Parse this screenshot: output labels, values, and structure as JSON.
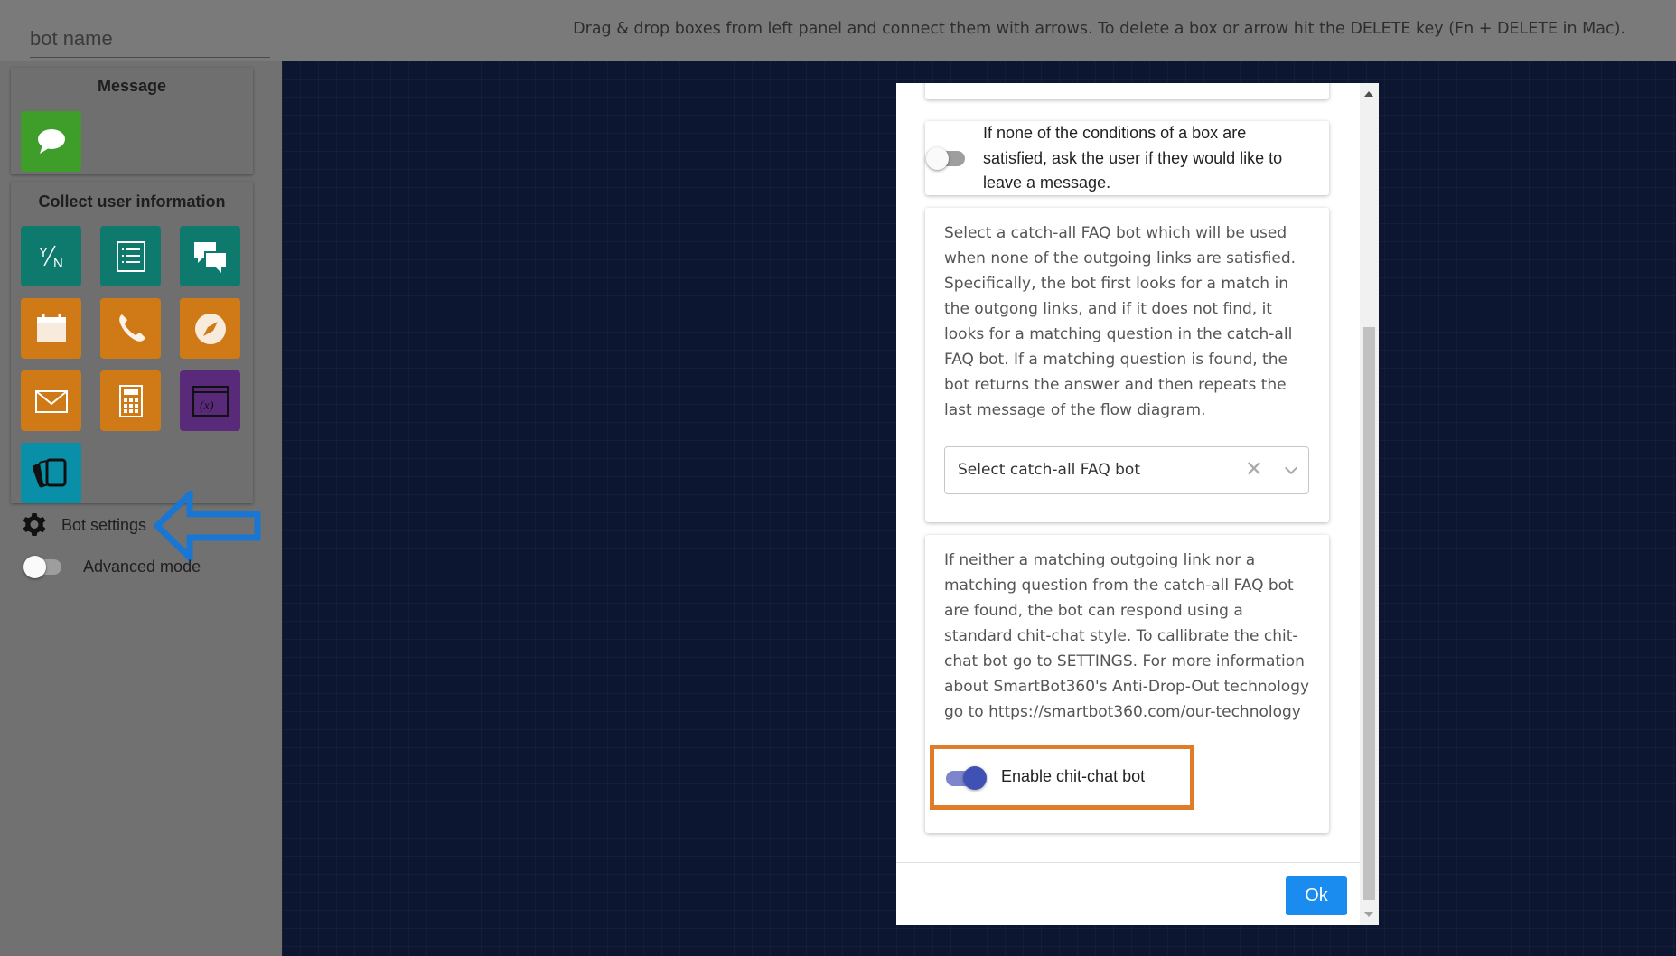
{
  "header": {
    "bot_name_placeholder": "bot name",
    "instructions": "Drag & drop boxes from left panel and connect them with arrows. To delete a box or arrow hit the DELETE key (Fn + DELETE in Mac)."
  },
  "palette": {
    "message_title": "Message",
    "collect_title": "Collect user information",
    "tiles": [
      {
        "name": "message-icon",
        "color": "#3f9d2a"
      },
      {
        "name": "yes-no-icon",
        "color": "#0e7a6d"
      },
      {
        "name": "list-icon",
        "color": "#0e7a6d"
      },
      {
        "name": "chat-icon",
        "color": "#0e7a6d"
      },
      {
        "name": "calendar-icon",
        "color": "#d07a17"
      },
      {
        "name": "phone-icon",
        "color": "#d07a17"
      },
      {
        "name": "compass-icon",
        "color": "#d07a17"
      },
      {
        "name": "email-icon",
        "color": "#d07a17"
      },
      {
        "name": "calculator-icon",
        "color": "#d07a17"
      },
      {
        "name": "variable-icon",
        "color": "#5a2a7a"
      },
      {
        "name": "cards-icon",
        "color": "#0a8fa8"
      }
    ]
  },
  "sidebar": {
    "bot_settings": "Bot settings",
    "advanced_mode": "Advanced mode",
    "arrow_color": "#1976d2"
  },
  "modal": {
    "no_condition_text": "If none of the conditions of a box are satisfied, ask the user if they would like to leave a message.",
    "faq_text": "Select a catch-all FAQ bot which will be used when none of the outgoing links are satisfied. Specifically, the bot first looks for a match in the outgong links, and if it does not find, it looks for a matching question in the catch-all FAQ bot. If a matching question is found, the bot returns the answer and then repeats the last message of the flow diagram.",
    "faq_select_placeholder": "Select catch-all FAQ bot",
    "chitchat_text": "If neither a matching outgoing link nor a matching question from the catch-all FAQ bot are found, the bot can respond using a standard chit-chat style. To callibrate the chit-chat bot go to SETTINGS. For more information about SmartBot360's Anti-Drop-Out technology go to https://smartbot360.com/our-technology",
    "chitchat_toggle_label": "Enable chit-chat bot",
    "chitchat_enabled": true,
    "highlight_color": "#e07b27",
    "ok_label": "Ok"
  }
}
